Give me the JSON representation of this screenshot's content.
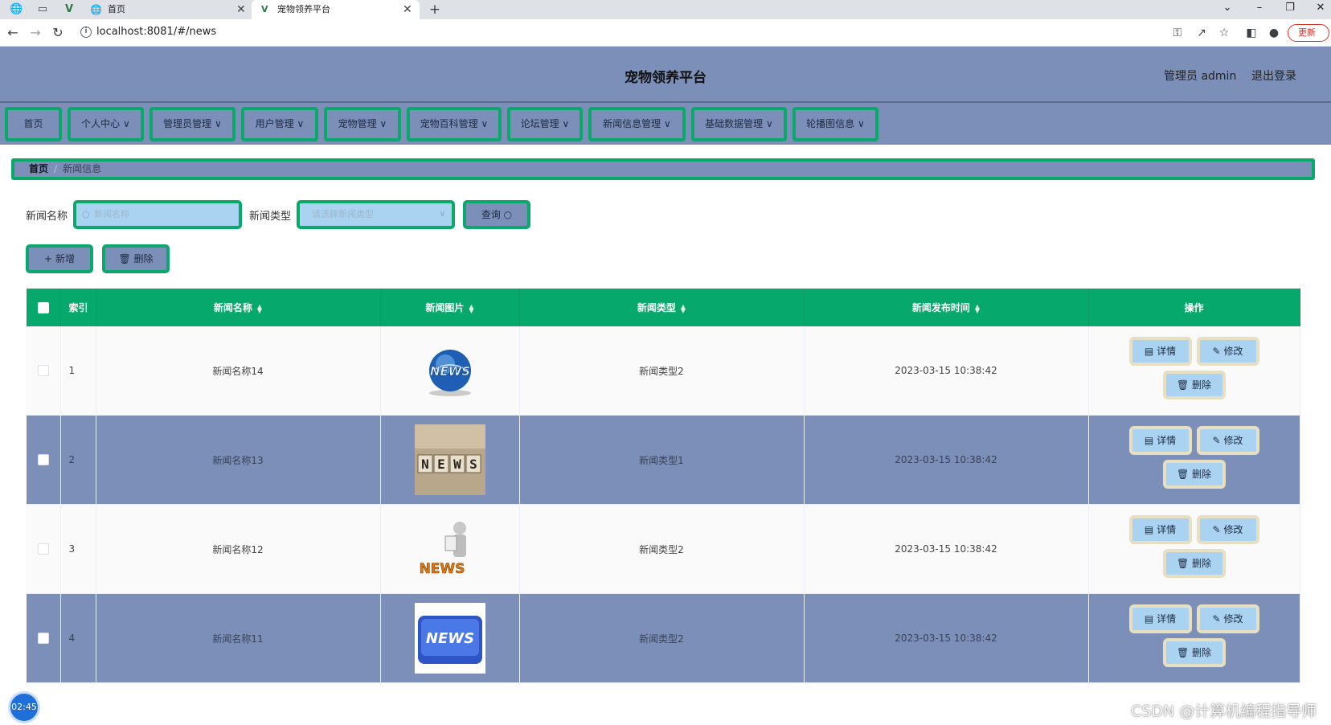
{
  "browser": {
    "tabs": [
      {
        "title": "首页"
      },
      {
        "title": "宠物领养平台"
      }
    ],
    "url": "localhost:8081/#/news",
    "update_label": "更新"
  },
  "header": {
    "title": "宠物领养平台",
    "admin_label": "管理员 admin",
    "logout_label": "退出登录"
  },
  "menu": [
    {
      "label": "首页"
    },
    {
      "label": "个人中心"
    },
    {
      "label": "管理员管理"
    },
    {
      "label": "用户管理"
    },
    {
      "label": "宠物管理"
    },
    {
      "label": "宠物百科管理"
    },
    {
      "label": "论坛管理"
    },
    {
      "label": "新闻信息管理"
    },
    {
      "label": "基础数据管理"
    },
    {
      "label": "轮播图信息"
    }
  ],
  "breadcrumb": {
    "home": "首页",
    "current": "新闻信息"
  },
  "search": {
    "name_label": "新闻名称",
    "name_placeholder": "新闻名称",
    "type_label": "新闻类型",
    "type_placeholder": "请选择新闻类型",
    "query_label": "查询"
  },
  "actions": {
    "add_label": "新增",
    "delete_label": "删除"
  },
  "table": {
    "headers": {
      "index": "索引",
      "name": "新闻名称",
      "image": "新闻图片",
      "type": "新闻类型",
      "time": "新闻发布时间",
      "ops": "操作"
    },
    "rows": [
      {
        "index": "1",
        "name": "新闻名称14",
        "image": "globe-news",
        "type": "新闻类型2",
        "time": "2023-03-15 10:38:42"
      },
      {
        "index": "2",
        "name": "新闻名称13",
        "image": "news-blocks",
        "type": "新闻类型1",
        "time": "2023-03-15 10:38:42"
      },
      {
        "index": "3",
        "name": "新闻名称12",
        "image": "figure-news",
        "type": "新闻类型2",
        "time": "2023-03-15 10:38:42"
      },
      {
        "index": "4",
        "name": "新闻名称11",
        "image": "news-key",
        "type": "新闻类型2",
        "time": "2023-03-15 10:38:42"
      }
    ],
    "op_labels": {
      "detail": "详情",
      "edit": "修改",
      "delete": "删除"
    }
  },
  "overlay": {
    "timer": "02:45",
    "watermark": "CSDN @计算机编程指导师"
  },
  "colors": {
    "accent": "#0aa86a",
    "header_bg": "#7b8fb8",
    "table_header": "#06a86b",
    "op_button": "#a9d3f0"
  }
}
